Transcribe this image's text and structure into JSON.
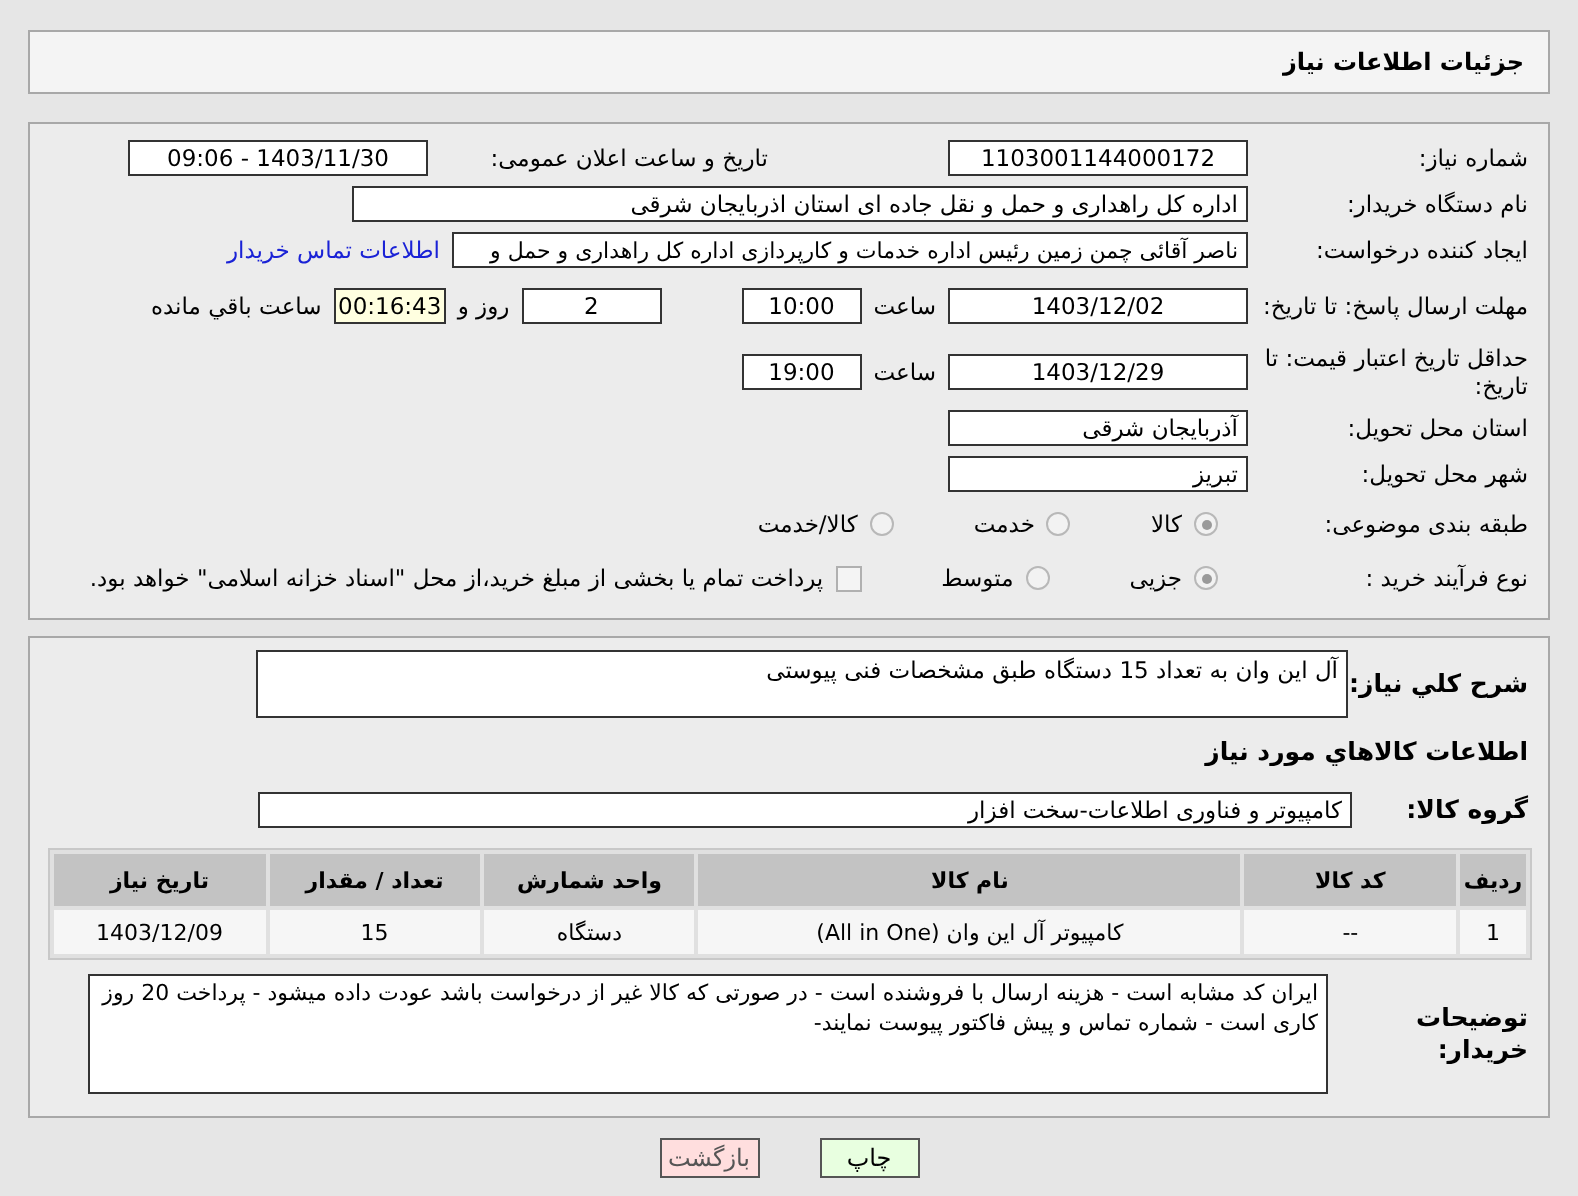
{
  "header": {
    "title": "جزئیات اطلاعات نیاز"
  },
  "details": {
    "need_number": {
      "label": "شماره نیاز:",
      "value": "1103001144000172"
    },
    "announce": {
      "label": "تاریخ و ساعت اعلان عمومی:",
      "value": "1403/11/30 - 09:06"
    },
    "buyer": {
      "label": "نام دستگاه خریدار:",
      "value": "اداره کل راهداری و حمل و نقل جاده ای استان اذربایجان شرقی"
    },
    "creator": {
      "label": "ایجاد کننده درخواست:",
      "value": "ناصر آقائی چمن زمین رئیس اداره خدمات و کارپردازی اداره کل راهداری و حمل و",
      "link": "اطلاعات تماس خریدار"
    },
    "deadline": {
      "label": "مهلت ارسال پاسخ: تا تاریخ:",
      "date": "1403/12/02",
      "time_label": "ساعت",
      "time": "10:00",
      "days": "2",
      "days_label": "روز و",
      "remaining": "00:16:43",
      "remaining_label": "ساعت باقي مانده"
    },
    "validity": {
      "label": "حداقل تاریخ اعتبار قیمت: تا تاریخ:",
      "date": "1403/12/29",
      "time_label": "ساعت",
      "time": "19:00"
    },
    "province": {
      "label": "استان محل تحویل:",
      "value": "آذربایجان شرقی"
    },
    "city": {
      "label": "شهر محل تحویل:",
      "value": "تبریز"
    },
    "category": {
      "label": "طبقه بندی موضوعی:",
      "options": [
        {
          "label": "کالا",
          "selected": true
        },
        {
          "label": "خدمت",
          "selected": false
        },
        {
          "label": "کالا/خدمت",
          "selected": false
        }
      ]
    },
    "process": {
      "label": "نوع فرآیند خرید :",
      "options": [
        {
          "label": "جزیی",
          "selected": true
        },
        {
          "label": "متوسط",
          "selected": false
        }
      ],
      "payment": {
        "label": "پرداخت تمام یا بخشی از مبلغ خرید،از محل \"اسناد خزانه اسلامی\" خواهد بود.",
        "checked": false
      }
    }
  },
  "goods": {
    "description": {
      "label": "شرح کلي نیاز:",
      "value": "آل این وان به تعداد 15 دستگاه طبق مشخصات فنی پیوستی"
    },
    "heading": "اطلاعات کالاهاي مورد نیاز",
    "group": {
      "label": "گروه کالا:",
      "value": "کامپیوتر و فناوری اطلاعات-سخت افزار"
    },
    "table": {
      "columns": [
        "ردیف",
        "کد کالا",
        "نام کالا",
        "واحد شمارش",
        "تعداد / مقدار",
        "تاریخ نیاز"
      ],
      "rows": [
        [
          "1",
          "--",
          "کامپیوتر آل این وان (All in One)",
          "دستگاه",
          "15",
          "1403/12/09"
        ]
      ]
    },
    "notes": {
      "label": "توضیحات خریدار:",
      "value": "ایران کد مشابه است - هزینه ارسال با فروشنده است - در صورتی که کالا غیر از درخواست باشد عودت داده میشود - پرداخت 20 روز کاری است - شماره تماس و پیش فاکتور پیوست نمایند-"
    }
  },
  "buttons": [
    {
      "kind": "print",
      "label": "چاپ"
    },
    {
      "kind": "back",
      "label": "بازگشت"
    }
  ]
}
